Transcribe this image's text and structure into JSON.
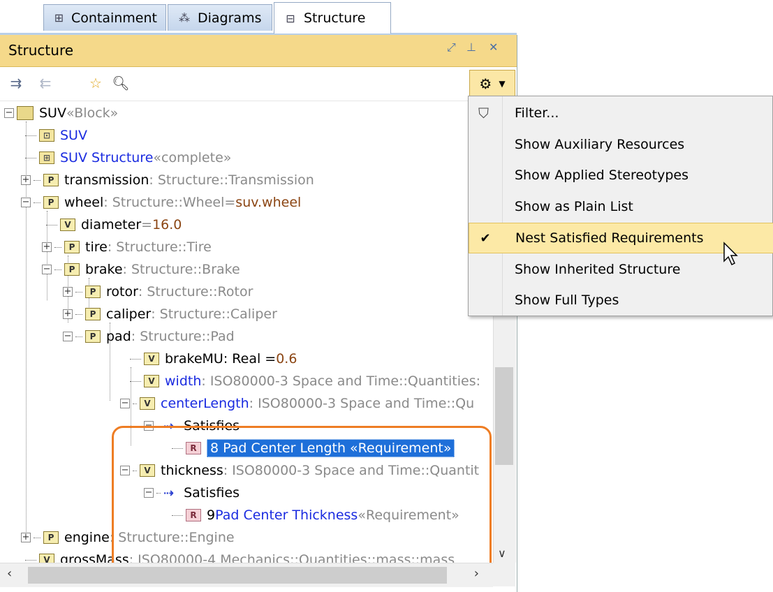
{
  "tabs": [
    {
      "label": "Containment",
      "icon": "containment-icon"
    },
    {
      "label": "Diagrams",
      "icon": "diagrams-icon"
    },
    {
      "label": "Structure",
      "icon": "structure-icon",
      "active": true
    }
  ],
  "panel": {
    "title": "Structure",
    "controls": [
      "restore-icon",
      "pin-icon",
      "close-icon"
    ]
  },
  "toolbar": {
    "icons": [
      "expand-icon",
      "collapse-icon",
      "star-icon",
      "search-icon",
      "gear-icon"
    ]
  },
  "tree": {
    "root": {
      "name": "SUV",
      "stereo": " «Block»"
    },
    "items": {
      "suv_diagram": "SUV",
      "suv_structure": "SUV Structure",
      "suv_structure_stereo": " «complete»",
      "transmission_name": "transmission",
      "transmission_type": " : Structure::Transmission",
      "wheel_name": "wheel",
      "wheel_type": " : Structure::Wheel",
      "wheel_eq": " = ",
      "wheel_val": "suv.wheel",
      "diameter_name": "diameter",
      "diameter_eq": " = ",
      "diameter_val": "16.0",
      "tire_name": "tire",
      "tire_type": " : Structure::Tire",
      "brake_name": "brake",
      "brake_type": " : Structure::Brake",
      "rotor_name": "rotor",
      "rotor_type": " : Structure::Rotor",
      "caliper_name": "caliper",
      "caliper_type": " : Structure::Caliper",
      "pad_name": "pad",
      "pad_type": " : Structure::Pad",
      "brakemu_name": "brakeMU",
      "brakemu_type": " : Real = ",
      "brakemu_val": "0.6",
      "width_name": "width",
      "width_type": " : ISO80000-3 Space and Time::Quantities:",
      "centerlength_name": "centerLength",
      "centerlength_type": " : ISO80000-3 Space and Time::Qu",
      "satisfies1": "Satisfies",
      "req8": "8 Pad Center Length «Requirement»",
      "thickness_name": "thickness",
      "thickness_type": " : ISO80000-3 Space and Time::Quantit",
      "satisfies2": "Satisfies",
      "req9_id": "9 ",
      "req9_name": "Pad Center Thickness",
      "req9_stereo": " «Requirement»",
      "engine_name": "engine",
      "engine_type": " : Structure::Engine",
      "grossmass_name": "grossMass",
      "grossmass_type": " : ISO80000-4 Mechanics::Quantities::mass::mass"
    },
    "icon_letters": {
      "part": "P",
      "value": "V",
      "requirement": "R"
    }
  },
  "menu": {
    "items": [
      {
        "label": "Filter...",
        "icon": "filter-icon"
      },
      {
        "label": "Show Auxiliary Resources"
      },
      {
        "label": "Show Applied Stereotypes"
      },
      {
        "label": "Show as Plain List"
      },
      {
        "label": "Nest Satisfied Requirements",
        "checked": true,
        "hover": true
      },
      {
        "label": "Show Inherited Structure"
      },
      {
        "label": "Show Full Types"
      }
    ]
  },
  "colors": {
    "title_bar": "#f5d98a",
    "selection": "#1e6fd9",
    "highlight_border": "#ee7d24",
    "menu_hover": "#fce9a6",
    "link_blue": "#1a2be0"
  }
}
